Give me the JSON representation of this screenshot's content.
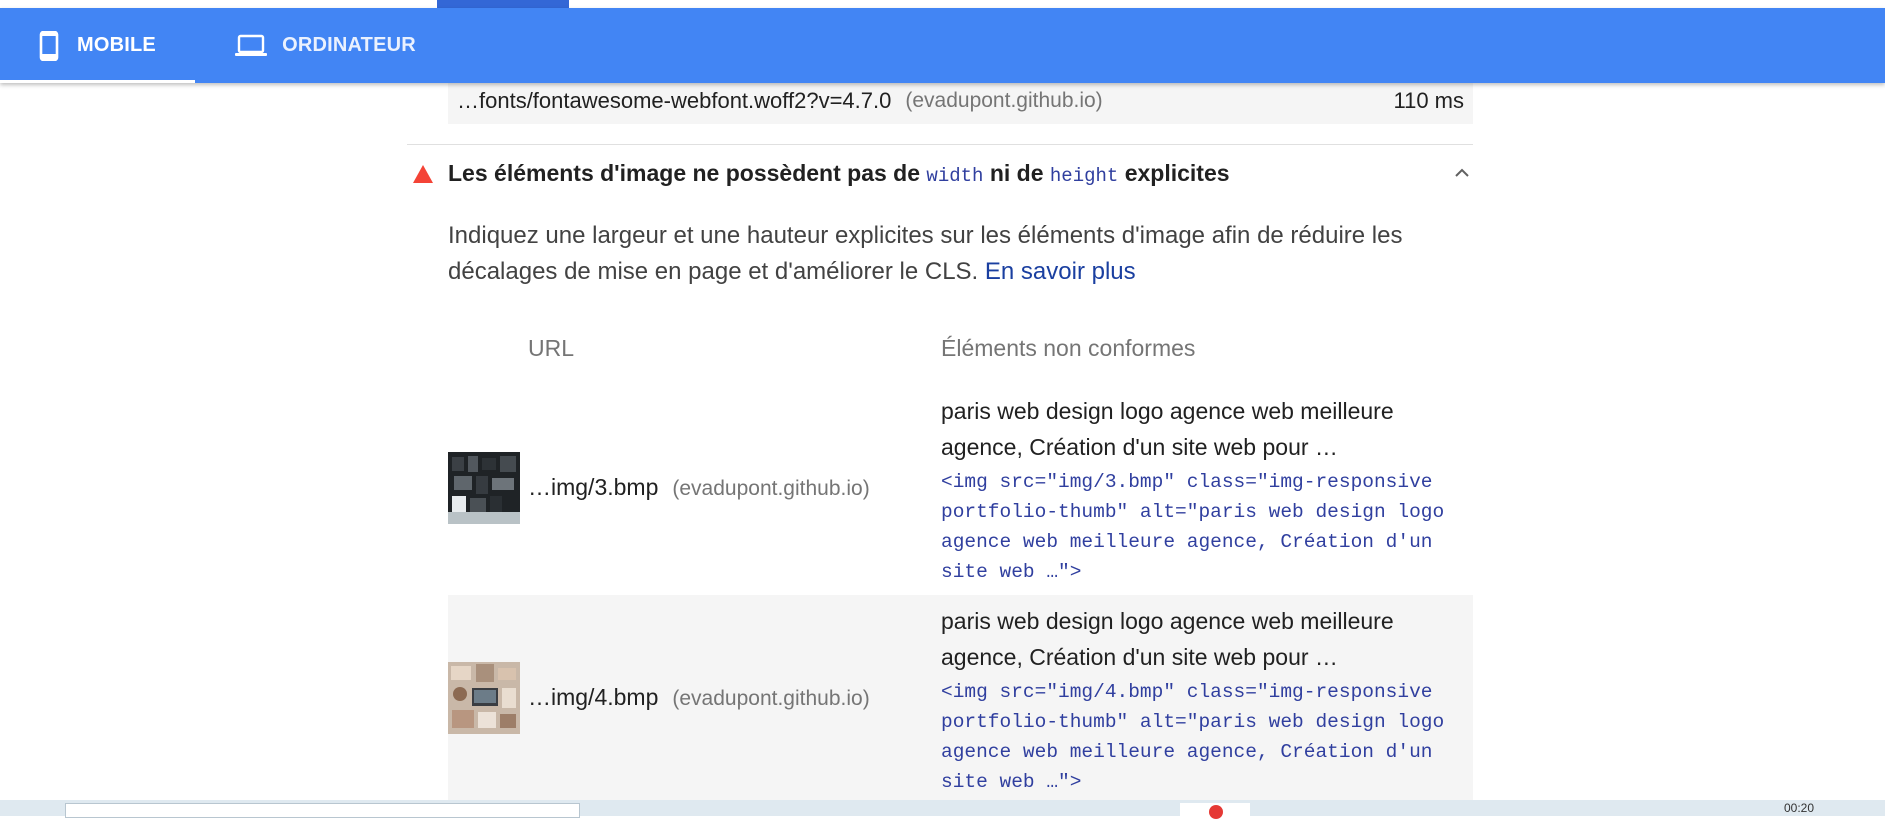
{
  "tabs": [
    {
      "label": "MOBILE",
      "icon": "smartphone-icon",
      "active": true
    },
    {
      "label": "ORDINATEUR",
      "icon": "laptop-icon",
      "active": false
    }
  ],
  "previous_row": {
    "url": "…fonts/fontawesome-webfont.woff2?v=4.7.0",
    "host": "(evadupont.github.io)",
    "time": "110 ms"
  },
  "audit": {
    "status_icon": "warning-triangle-icon",
    "status_color": "#f44336",
    "title_part1": "Les éléments d'image ne possèdent pas de",
    "code1": "width",
    "title_part2": "ni de",
    "code2": "height",
    "title_part3": "explicites",
    "description": "Indiquez une largeur et une hauteur explicites sur les éléments d'image afin de réduire les décalages de mise en page et d'améliorer le CLS.",
    "learn_more": "En savoir plus",
    "columns": {
      "url": "URL",
      "elements": "Éléments non conformes"
    },
    "rows": [
      {
        "url": "…img/3.bmp",
        "host": "(evadupont.github.io)",
        "label": "paris web design logo agence web meilleure agence, Création d'un site web pour …",
        "snippet": "<img src=\"img/3.bmp\" class=\"img-responsive portfolio-thumb\" alt=\"paris web design logo agence web meilleure agence, Création d'un site web …\">"
      },
      {
        "url": "…img/4.bmp",
        "host": "(evadupont.github.io)",
        "label": "paris web design logo agence web meilleure agence, Création d'un site web pour …",
        "snippet": "<img src=\"img/4.bmp\" class=\"img-responsive portfolio-thumb\" alt=\"paris web design logo agence web meilleure agence, Création d'un site web …\">"
      }
    ]
  },
  "taskbar": {
    "clock": "00:20"
  },
  "colors": {
    "tabbar": "#4285f4",
    "link": "#1a3fa0",
    "code": "#303f9f"
  }
}
